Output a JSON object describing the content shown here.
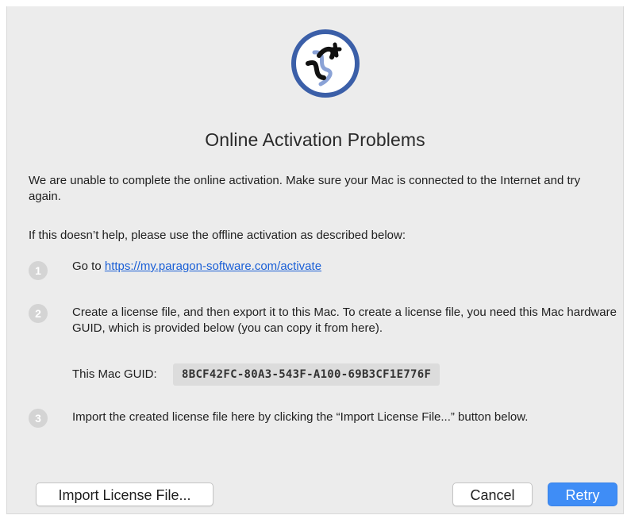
{
  "dialog": {
    "logo_icon": "paragon-logo-icon",
    "title": "Online Activation Problems",
    "paragraph1": "We are unable to complete the online activation. Make sure your Mac is connected to the Internet and try again.",
    "paragraph2": "If this doesn’t help, please use the offline activation as described below:",
    "steps": [
      {
        "number": "1",
        "prefix": "Go to ",
        "link": "https://my.paragon-software.com/activate"
      },
      {
        "number": "2",
        "text": "Create a license file, and then export it to this Mac. To create a license file, you need this Mac hardware GUID, which is provided below (you can copy it from here)."
      },
      {
        "number": "3",
        "text": "Import the created license file here by clicking the “Import License File...” button below."
      }
    ],
    "guid_label": "This Mac GUID:",
    "guid_value": "8BCF42FC-80A3-543F-A100-69B3CF1E776F"
  },
  "buttons": {
    "import": "Import License File...",
    "cancel": "Cancel",
    "retry": "Retry"
  },
  "colors": {
    "accent": "#3f8df6",
    "link": "#1a5fd6",
    "dialog_bg": "#ececec",
    "logo_ring": "#3b5fa8"
  }
}
